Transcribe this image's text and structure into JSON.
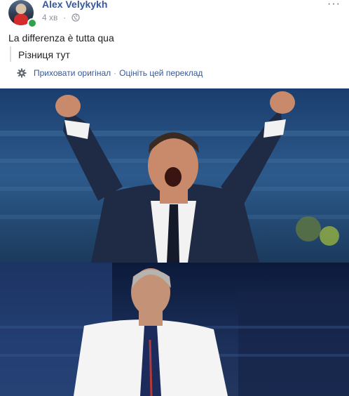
{
  "post": {
    "author": "Alex Velykykh",
    "time": "4 хв",
    "text": "La differenza è tutta qua",
    "translation": "Різниця тут",
    "hide_original_label": "Приховати оригінал",
    "separator": "·",
    "rate_translation_label": "Оцініть цей переклад",
    "more_label": "···"
  },
  "images": [
    {
      "name": "celebrating-coach-photo"
    },
    {
      "name": "standing-coach-photo"
    }
  ],
  "colors": {
    "author_link": "#385898",
    "meta_text": "#90949c",
    "presence": "#31a24c"
  },
  "icons": [
    "avatar",
    "globe-icon",
    "more-icon",
    "gear-icon"
  ]
}
